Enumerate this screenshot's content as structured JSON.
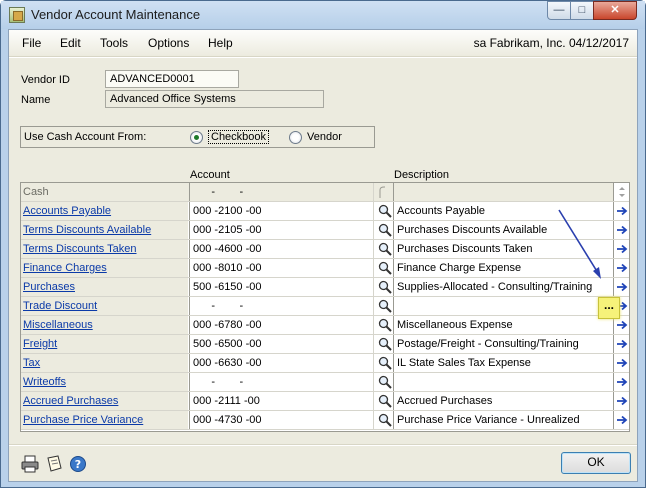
{
  "window": {
    "title": "Vendor Account Maintenance",
    "controls": {
      "minimize": "—",
      "maximize": "□",
      "close": "✕"
    }
  },
  "menu": {
    "items": [
      "File",
      "Edit",
      "Tools",
      "Options",
      "Help"
    ],
    "company_info": "sa  Fabrikam, Inc.  04/12/2017"
  },
  "vendor": {
    "id_label": "Vendor ID",
    "id_value": "ADVANCED0001",
    "name_label": "Name",
    "name_value": "Advanced Office Systems"
  },
  "cash_account": {
    "label": "Use Cash Account From:",
    "options": [
      "Checkbook",
      "Vendor"
    ],
    "selected": "Checkbook"
  },
  "grid": {
    "account_header": "Account",
    "description_header": "Description",
    "header_row": {
      "label": "Cash",
      "account": "      -        -"
    },
    "rows": [
      {
        "label": "Accounts Payable",
        "account": "000 -2100 -00",
        "description": "Accounts Payable"
      },
      {
        "label": "Terms Discounts Available",
        "account": "000 -2105 -00",
        "description": "Purchases Discounts Available"
      },
      {
        "label": "Terms Discounts Taken",
        "account": "000 -4600 -00",
        "description": "Purchases Discounts Taken"
      },
      {
        "label": "Finance Charges",
        "account": "000 -8010 -00",
        "description": "Finance Charge Expense"
      },
      {
        "label": "Purchases",
        "account": "500 -6150 -00",
        "description": "Supplies-Allocated - Consulting/Training"
      },
      {
        "label": "Trade Discount",
        "account": "      -        -",
        "description": ""
      },
      {
        "label": "Miscellaneous",
        "account": "000 -6780 -00",
        "description": "Miscellaneous Expense"
      },
      {
        "label": "Freight",
        "account": "500 -6500 -00",
        "description": "Postage/Freight - Consulting/Training"
      },
      {
        "label": "Tax",
        "account": "000 -6630 -00",
        "description": "IL State Sales Tax Expense"
      },
      {
        "label": "Writeoffs",
        "account": "      -        -",
        "description": ""
      },
      {
        "label": "Accrued Purchases",
        "account": "000 -2111 -00",
        "description": "Accrued Purchases"
      },
      {
        "label": "Purchase Price Variance",
        "account": "000 -4730 -00",
        "description": "Purchase Price Variance - Unrealized"
      }
    ]
  },
  "ellipsis_button": "...",
  "ok_label": "OK",
  "icons": [
    "printer-icon",
    "note-icon",
    "help-icon",
    "lookup-icon",
    "expand-arrow-icon"
  ],
  "colors": {
    "link": "#0b3aa8",
    "highlight": "#f6f27a",
    "annotation_arrow": "#2a3fae"
  }
}
